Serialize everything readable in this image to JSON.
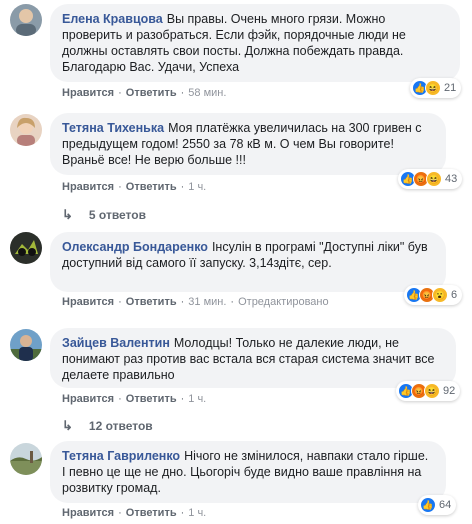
{
  "comments": [
    {
      "author": "Елена Кравцова",
      "text": "Вы правы. Очень много грязи. Можно проверить и разобраться. Если фэйк, порядочные люди не должны оставлять свои посты. Должна побеждать правда. Благодарю Вас. Удачи, Успеха",
      "like": "Нравится",
      "reply": "Ответить",
      "time": "58 мин.",
      "reaction_count": "21"
    },
    {
      "author": "Тетяна Тихенька",
      "text": "Моя платёжка увеличилась на 300 гривен с предыдущем годом! 2550 за 78 кВ м. О чем Вы говорите! Враньё все! Не верю больше !!!",
      "like": "Нравится",
      "reply": "Ответить",
      "time": "1 ч.",
      "reaction_count": "43",
      "replies_label": "5 ответов"
    },
    {
      "author": "Олександр Бондаренко",
      "text": "Інсулін в програмі \"Доступні ліки\" був доступний від самого її запуску. 3,14здітє, сер.",
      "like": "Нравится",
      "reply": "Ответить",
      "time": "31 мин.",
      "edited": "Отредактировано",
      "reaction_count": "6"
    },
    {
      "author": "Зайцев Валентин",
      "text": "Молодцы! Только не далекие люди, не понимают раз против вас встала вся старая система значит все делаете правильно",
      "like": "Нравится",
      "reply": "Ответить",
      "time": "1 ч.",
      "reaction_count": "92",
      "replies_label": "12 ответов"
    },
    {
      "author": "Тетяна Гавриленко",
      "text": "Нічого не змінилося, навпаки стало гірше. І певно це ще не дно. Цьогоріч буде видно ваше правління на розвитку громад.",
      "like": "Нравится",
      "reply": "Ответить",
      "time": "1 ч.",
      "reaction_count": "64"
    }
  ],
  "colors": {
    "author": "#385898",
    "bubble": "#f2f3f5",
    "like_reaction": "#1877f2",
    "haha_reaction": "#f7b928",
    "angry_reaction": "#e9710f"
  }
}
